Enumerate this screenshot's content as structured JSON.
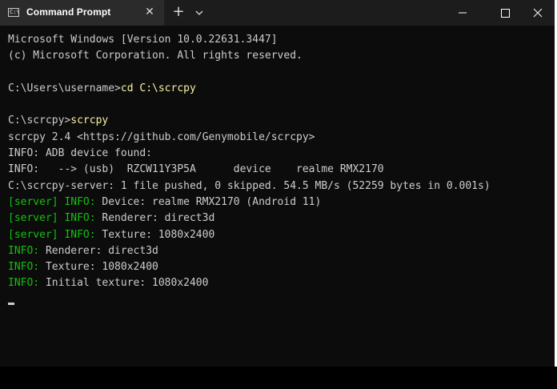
{
  "tab": {
    "title": "Command Prompt",
    "icon": "terminal-icon"
  },
  "titlebar": {
    "new_tab": "+",
    "dropdown": "chevron-down-icon",
    "minimize": "minimize-icon",
    "maximize": "maximize-icon",
    "close": "close-icon"
  },
  "terminal": {
    "lines": [
      {
        "segments": [
          {
            "text": "Microsoft Windows [Version 10.0.22631.3447]",
            "color": "default"
          }
        ]
      },
      {
        "segments": [
          {
            "text": "(c) Microsoft Corporation. All rights reserved.",
            "color": "default"
          }
        ]
      },
      {
        "segments": [
          {
            "text": "",
            "color": "default"
          }
        ]
      },
      {
        "segments": [
          {
            "text": "C:\\Users\\username>",
            "color": "default"
          },
          {
            "text": "cd C:\\scrcpy",
            "color": "yellow"
          }
        ]
      },
      {
        "segments": [
          {
            "text": "",
            "color": "default"
          }
        ]
      },
      {
        "segments": [
          {
            "text": "C:\\scrcpy>",
            "color": "default"
          },
          {
            "text": "scrcpy",
            "color": "yellow"
          }
        ]
      },
      {
        "segments": [
          {
            "text": "scrcpy 2.4 <https://github.com/Genymobile/scrcpy>",
            "color": "default"
          }
        ]
      },
      {
        "segments": [
          {
            "text": "INFO: ADB device found:",
            "color": "default"
          }
        ]
      },
      {
        "segments": [
          {
            "text": "INFO:   --> (usb)  RZCW11Y3P5A      device    realme RMX2170",
            "color": "default"
          }
        ]
      },
      {
        "segments": [
          {
            "text": "C:\\scrcpy-server: 1 file pushed, 0 skipped. 54.5 MB/s (52259 bytes in 0.001s)",
            "color": "default"
          }
        ]
      },
      {
        "segments": [
          {
            "text": "[server] INFO:",
            "color": "green"
          },
          {
            "text": " Device: realme RMX2170 (Android 11)",
            "color": "default"
          }
        ]
      },
      {
        "segments": [
          {
            "text": "[server] INFO:",
            "color": "green"
          },
          {
            "text": " Renderer: direct3d",
            "color": "default"
          }
        ]
      },
      {
        "segments": [
          {
            "text": "[server] INFO:",
            "color": "green"
          },
          {
            "text": " Texture: 1080x2400",
            "color": "default"
          }
        ]
      },
      {
        "segments": [
          {
            "text": "INFO:",
            "color": "green"
          },
          {
            "text": " Renderer: direct3d",
            "color": "default"
          }
        ]
      },
      {
        "segments": [
          {
            "text": "INFO:",
            "color": "green"
          },
          {
            "text": " Texture: 1080x2400",
            "color": "default"
          }
        ]
      },
      {
        "segments": [
          {
            "text": "INFO:",
            "color": "green"
          },
          {
            "text": " Initial texture: 1080x2400",
            "color": "default"
          }
        ]
      }
    ]
  },
  "colors": {
    "default": "#cccccc",
    "yellow": "#f9f1a5",
    "green": "#13c10e",
    "background": "#0c0c0c"
  }
}
